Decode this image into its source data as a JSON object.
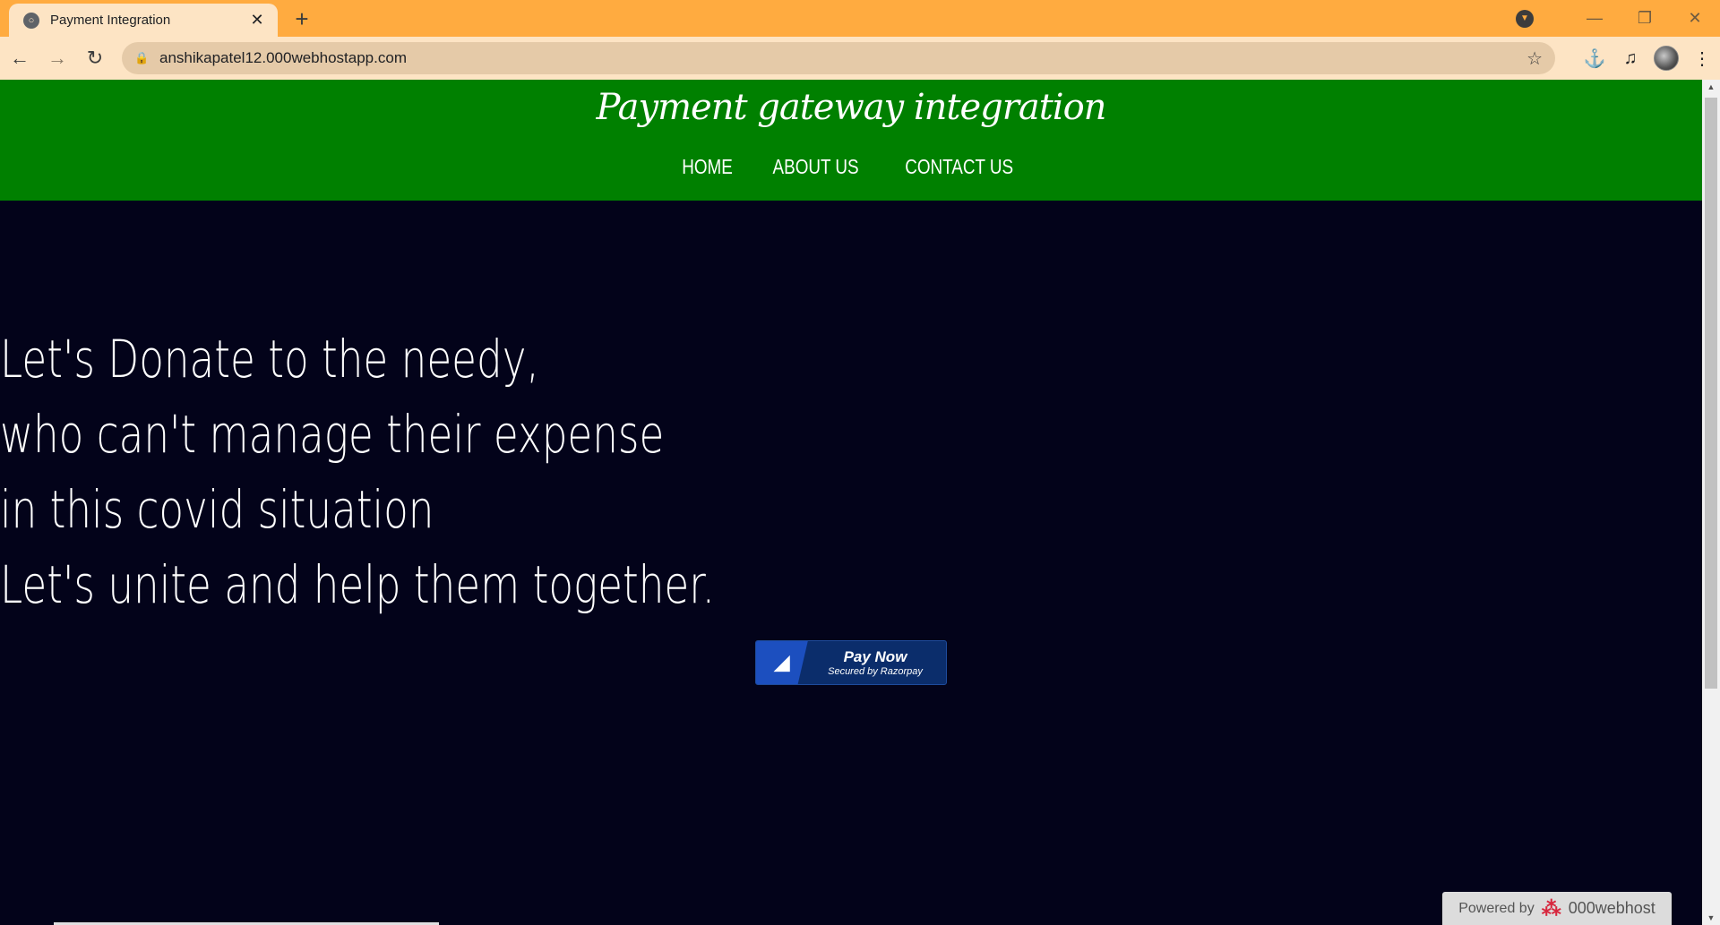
{
  "browser": {
    "tab_title": "Payment Integration",
    "url": "anshikapatel12.000webhostapp.com"
  },
  "site": {
    "title": "Payment gateway integration",
    "nav": [
      "HOME",
      "ABOUT US",
      "CONTACT US"
    ],
    "hero_lines": [
      "Let's Donate to the needy,",
      "who can't manage their expense",
      "in this covid situation",
      "Let's unite and help them together."
    ],
    "pay_button": {
      "label": "Pay Now",
      "sub": "Secured by Razorpay"
    },
    "powered": {
      "label": "Powered by",
      "brand": "000webhost"
    }
  },
  "colors": {
    "header_bg": "#008000",
    "page_bg": "#03031a",
    "tab_strip": "#ffab40",
    "pay_button": "#0b2d6b"
  }
}
